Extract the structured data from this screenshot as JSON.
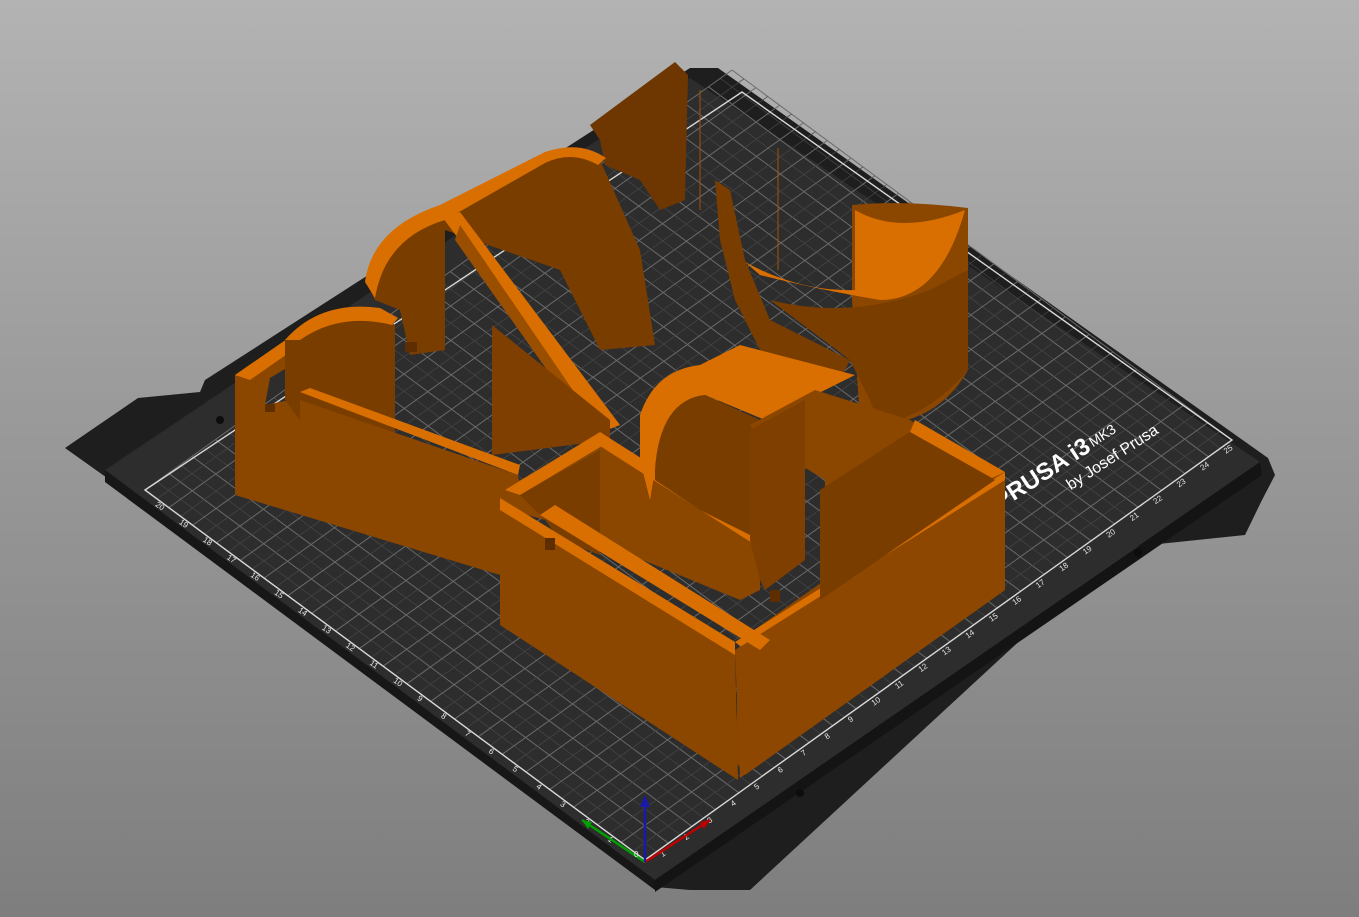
{
  "viewport": {
    "background_top": "#b3b3b3",
    "background_bottom": "#7e7e7e"
  },
  "bed": {
    "brand_line1": "PRUSA i3",
    "brand_model": "MK3",
    "brand_line2": "by Josef Prusa",
    "sheet_color": "#2d2d2d",
    "frame_color": "#1e1e1e",
    "grid_color": "#5a5a5a",
    "x_ticks": [
      "1",
      "2",
      "3",
      "4",
      "5",
      "6",
      "7",
      "8",
      "9",
      "10",
      "11",
      "12",
      "13",
      "14",
      "15",
      "16",
      "17",
      "18",
      "19",
      "20",
      "21",
      "22",
      "23",
      "24",
      "25"
    ],
    "y_ticks": [
      "1",
      "2",
      "3",
      "4",
      "5",
      "6",
      "7",
      "8",
      "9",
      "10",
      "11",
      "12",
      "13",
      "14",
      "15",
      "16",
      "17",
      "18",
      "19",
      "20"
    ],
    "origin_label": "0"
  },
  "model": {
    "color_top": "#d96f00",
    "color_side": "#8b4600",
    "color_shade": "#6e3600"
  },
  "axes": {
    "x_color": "#c00000",
    "y_color": "#00a000",
    "z_color": "#1a1aa8"
  }
}
